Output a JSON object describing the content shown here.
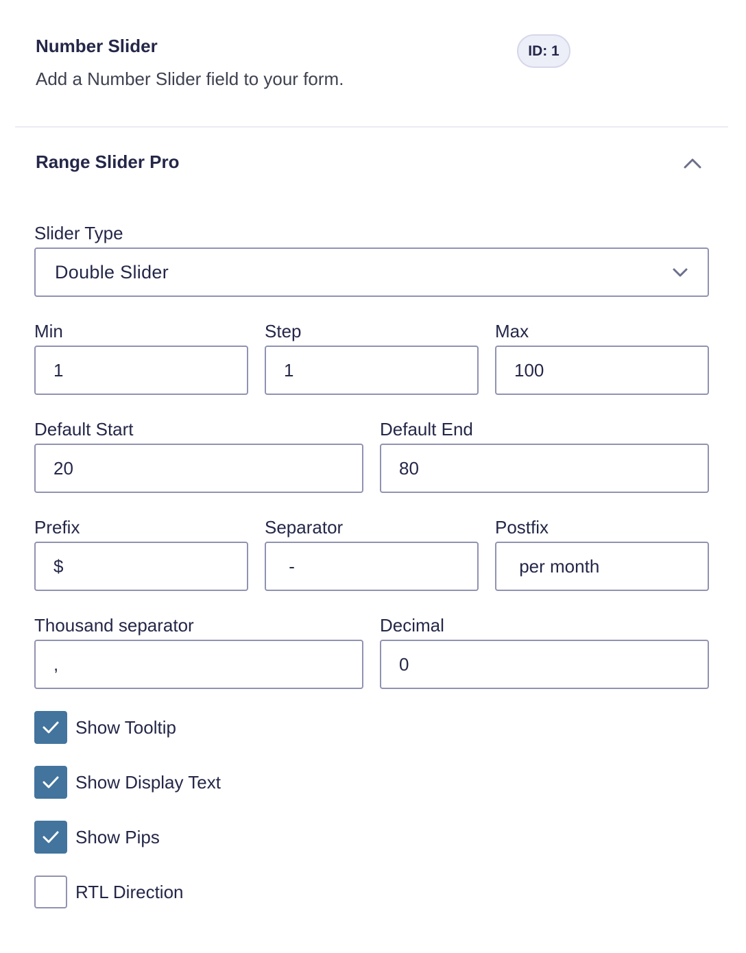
{
  "field": {
    "title": "Number Slider",
    "description": "Add a Number Slider field to your form.",
    "id_badge": "ID: 1"
  },
  "section": {
    "title": "Range Slider Pro",
    "toggle_icon": "chevron-up-icon"
  },
  "slider_type": {
    "label": "Slider Type",
    "value": "Double Slider",
    "icon": "chevron-down-icon"
  },
  "min": {
    "label": "Min",
    "value": "1"
  },
  "step": {
    "label": "Step",
    "value": "1"
  },
  "max": {
    "label": "Max",
    "value": "100"
  },
  "default_start": {
    "label": "Default Start",
    "value": "20"
  },
  "default_end": {
    "label": "Default End",
    "value": "80"
  },
  "prefix": {
    "label": "Prefix",
    "value": "$"
  },
  "separator": {
    "label": "Separator",
    "value": " - "
  },
  "postfix": {
    "label": "Postfix",
    "value": " per month"
  },
  "thousand_separator": {
    "label": "Thousand separator",
    "value": ","
  },
  "decimal": {
    "label": "Decimal",
    "value": "0"
  },
  "options": [
    {
      "label": "Show Tooltip",
      "checked": true
    },
    {
      "label": "Show Display Text",
      "checked": true
    },
    {
      "label": "Show Pips",
      "checked": true
    },
    {
      "label": "RTL Direction",
      "checked": false
    }
  ],
  "colors": {
    "checkbox_checked": "#42749d",
    "input_border": "#9092b2",
    "text": "#242748",
    "badge_bg": "#eceef8"
  }
}
